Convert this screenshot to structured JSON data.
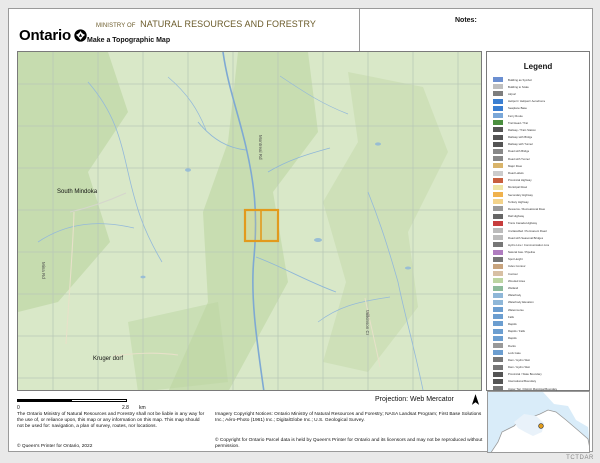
{
  "header": {
    "logo_word": "Ontario",
    "ministry_prefix": "MINISTRY OF",
    "ministry_name": "NATURAL RESOURCES AND FORESTRY",
    "product_title": "Make a Topographic Map",
    "notes_label": "Notes:"
  },
  "map": {
    "places": [
      {
        "name": "South Mindoka"
      },
      {
        "name": "Kruger dorf"
      }
    ],
    "road_labels": [
      {
        "name": "Mina Rd"
      },
      {
        "name": "Montreal Rd"
      },
      {
        "name": "Wilkinson Cr"
      }
    ],
    "colors": {
      "land": "#d9e8c8",
      "forest": "#bcd5a2",
      "water": "#8fb7d8",
      "grid": "#b9c9b7",
      "parcel_outline": "#e29a1d"
    }
  },
  "legend": {
    "title": "Legend",
    "items": [
      {
        "label": "Building as Symbol",
        "color": "#6b8fd1"
      },
      {
        "label": "Building to Scale",
        "color": "#bfbfbf"
      },
      {
        "label": "Airport",
        "color": "#7e7e7e"
      },
      {
        "label": "Heliport / Helipad / Aerodrome",
        "color": "#3b7fd1"
      },
      {
        "label": "Seaplane Base",
        "color": "#3b7fd1"
      },
      {
        "label": "Ferry Route",
        "color": "#7aa7d8"
      },
      {
        "label": "Trail Head / Trail",
        "color": "#4b8f3f"
      },
      {
        "label": "Railway / Train Station",
        "color": "#555555"
      },
      {
        "label": "Railway with Bridge",
        "color": "#555555"
      },
      {
        "label": "Railway with Tunnel",
        "color": "#555555"
      },
      {
        "label": "Road with Bridge",
        "color": "#888888"
      },
      {
        "label": "Road with Tunnel",
        "color": "#888888"
      },
      {
        "label": "Major Road",
        "color": "#d9b46a"
      },
      {
        "label": "Road Labels",
        "color": "#cccccc"
      },
      {
        "label": "Provincial Highway",
        "color": "#c85f3e"
      },
      {
        "label": "Municipal Road",
        "color": "#efe6a6"
      },
      {
        "label": "Secondary Highway",
        "color": "#f0b24d"
      },
      {
        "label": "Tertiary Highway",
        "color": "#f3d38b"
      },
      {
        "label": "Resource / Recreational Road",
        "color": "#9a9a9a"
      },
      {
        "label": "Rail Highway",
        "color": "#666666"
      },
      {
        "label": "Trans Canada Highway",
        "color": "#c73d3d"
      },
      {
        "label": "Unclassified / Permanent Road",
        "color": "#bbbbbb"
      },
      {
        "label": "Road with Seasonal Bridges",
        "color": "#bbbbbb"
      },
      {
        "label": "Hydro Line / Communication Line",
        "color": "#777777"
      },
      {
        "label": "Natural Gas / Pipeline",
        "color": "#b07dc0"
      },
      {
        "label": "Spot Height",
        "color": "#777777"
      },
      {
        "label": "Index Contour",
        "color": "#c8a47e"
      },
      {
        "label": "Contour",
        "color": "#d8c0a4"
      },
      {
        "label": "Wooded Area",
        "color": "#bcd5a2"
      },
      {
        "label": "Wetland",
        "color": "#8dbb9b"
      },
      {
        "label": "Waterbody",
        "color": "#8fb7d8"
      },
      {
        "label": "Waterbody Elevation",
        "color": "#8fb7d8"
      },
      {
        "label": "Watercourse",
        "color": "#6c9ed0"
      },
      {
        "label": "Falls",
        "color": "#6c9ed0"
      },
      {
        "label": "Rapids",
        "color": "#6c9ed0"
      },
      {
        "label": "Rapids / Falls",
        "color": "#6c9ed0"
      },
      {
        "label": "Rapids",
        "color": "#6c9ed0"
      },
      {
        "label": "Rocks",
        "color": "#999999"
      },
      {
        "label": "Lock Gate",
        "color": "#6c9ed0"
      },
      {
        "label": "Dam / Hydro Weir",
        "color": "#777777"
      },
      {
        "label": "Dam / Hydro Weir",
        "color": "#777777"
      },
      {
        "label": "Provincial / State Boundary",
        "color": "#555555"
      },
      {
        "label": "International Boundary",
        "color": "#555555"
      },
      {
        "label": "Upper Tier / District Municipal Boundary",
        "color": "#777777"
      },
      {
        "label": "Lower Tier / Single Tier Municipal Boundary",
        "color": "#999999"
      },
      {
        "label": "Lot Line",
        "color": "#bbbbbb"
      },
      {
        "label": "Indian Reserve",
        "color": "#b9846b"
      },
      {
        "label": "Provincial Park",
        "color": "#9fd08f"
      },
      {
        "label": "National Park",
        "color": "#6fb36c"
      },
      {
        "label": "Conservation Reserve",
        "color": "#c4dfa3"
      },
      {
        "label": "Military Lands",
        "color": "#e0b0a8"
      }
    ]
  },
  "footer": {
    "scale_start": "0",
    "scale_end": "2.8",
    "scale_unit": "km",
    "projection": "Projection: Web Mercator",
    "disclaimer": "The Ontario Ministry of Natural Resources and Forestry shall not be liable in any way for the use of, or reliance upon, this map or any information on this map.  This map should not be used for: navigation, a plan of survey, routes, nor locations.",
    "copyright": "© Queen's Printer for Ontario, 2022",
    "imagery": "Imagery Copyright Notices: Ontario Ministry of Natural Resources and Forestry; NASA Landsat Program; First Base Solutions Inc.; Aéro-Photo (1961) Inc.; DigitalGlobe Inc.; U.S. Geological Survey.",
    "parcel": "© Copyright for Ontario Parcel data is held by Queen's Printer for Ontario and its licensors and may not be reproduced without permission."
  },
  "watermark": "TCTDAR"
}
